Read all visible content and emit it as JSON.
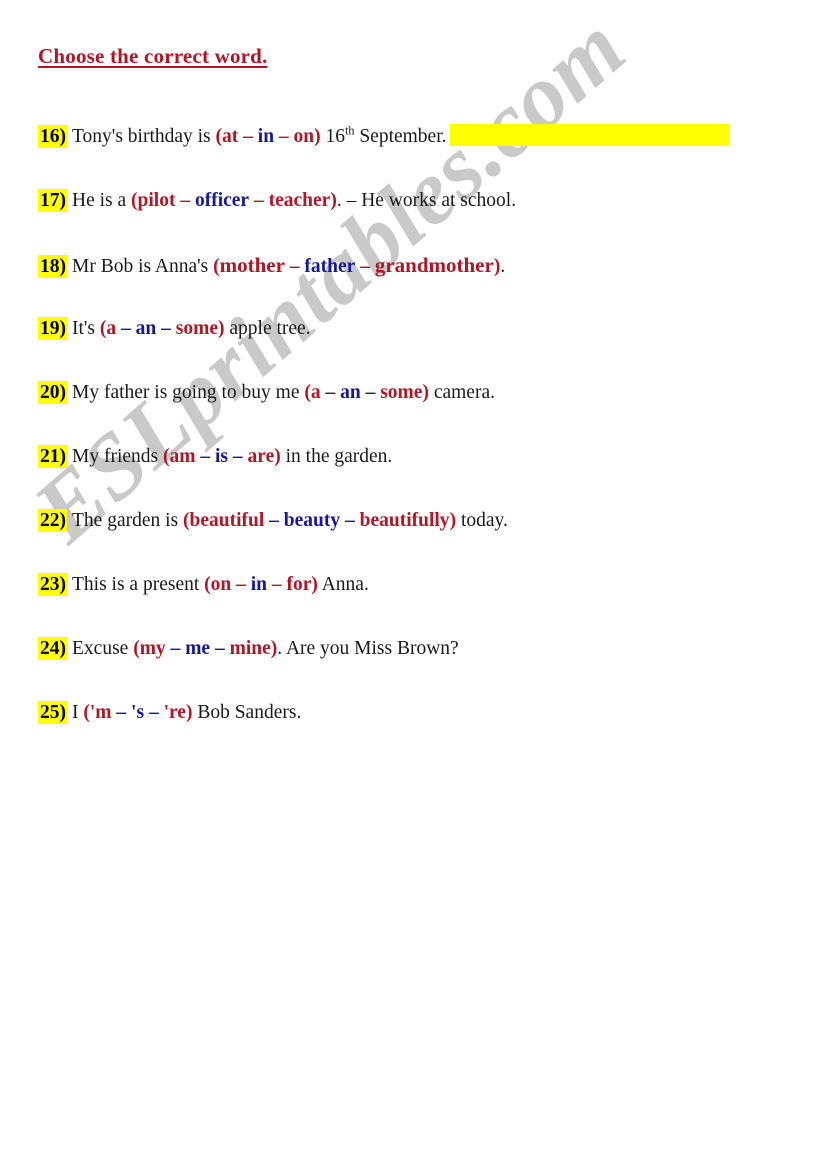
{
  "document": {
    "title": "Choose the correct word.",
    "title_color": "#b01626",
    "highlight_color": "#ffff00",
    "option_red": "#b01626",
    "option_blue": "#171799",
    "watermark": "ESLprintables.com"
  },
  "questions": [
    {
      "number": "16)",
      "before": "Tony's birthday is ",
      "open_paren": "(",
      "opt1": "at",
      "dash1": "–",
      "opt2": "in",
      "dash2": "–",
      "opt3": "on",
      "close_paren": ")",
      "after_pre": " 16",
      "after_sup": "th",
      "after": " September.",
      "has_answer_bar": true
    },
    {
      "number": "17)",
      "before": "He is a ",
      "open_paren": "(",
      "opt1": "pilot",
      "dash1": "–",
      "opt2": "officer",
      "dash2": "–",
      "opt3": "teacher",
      "close_paren": ")",
      "after": ". – He works at school."
    },
    {
      "number": "18)",
      "before": "Mr Bob is Anna's ",
      "open_paren": "(",
      "opt1": "mother",
      "dash1": "–",
      "opt2": "father",
      "dash2": "–",
      "opt3": "grandmother",
      "close_paren": ")",
      "after": "."
    },
    {
      "number": "19)",
      "before": "It's ",
      "open_paren": "(",
      "opt1": "a",
      "dash1": "–",
      "opt2": "an",
      "dash2": "–",
      "opt3": "some",
      "close_paren": ")",
      "after": " apple tree."
    },
    {
      "number": "20)",
      "before": "My father is going to buy me ",
      "open_paren": "(",
      "opt1": "a",
      "dash1": "–",
      "opt2": "an",
      "dash2": "–",
      "opt3": "some",
      "close_paren": ")",
      "after": " camera."
    },
    {
      "number": "21)",
      "before": "My friends ",
      "open_paren": "(",
      "opt1": "am",
      "dash1": "–",
      "opt2": "is",
      "dash2": "–",
      "opt3": "are",
      "close_paren": ")",
      "after": " in the garden."
    },
    {
      "number": "22)",
      "before": "The garden is ",
      "open_paren": "(",
      "opt1": "beautiful",
      "dash1": "–",
      "opt2": "beauty",
      "dash2": "–",
      "opt3": "beautifully",
      "close_paren": ")",
      "after": " today."
    },
    {
      "number": "23)",
      "before": "This is a present ",
      "open_paren": "(",
      "opt1": "on",
      "dash1": "–",
      "opt2": "in",
      "dash2": "–",
      "opt3": "for",
      "close_paren": ")",
      "after": " Anna."
    },
    {
      "number": "24)",
      "before": "Excuse ",
      "open_paren": "(",
      "opt1": "my",
      "dash1": "–",
      "opt2": "me",
      "dash2": "–",
      "opt3": "mine",
      "close_paren": ")",
      "after": ". Are you Miss Brown?"
    },
    {
      "number": "25)",
      "before": "I ",
      "open_paren": "(",
      "opt1": "'m",
      "dash1": "–",
      "opt2": "'s",
      "dash2": "–",
      "opt3": "'re",
      "close_paren": ")",
      "after": " Bob Sanders."
    }
  ]
}
